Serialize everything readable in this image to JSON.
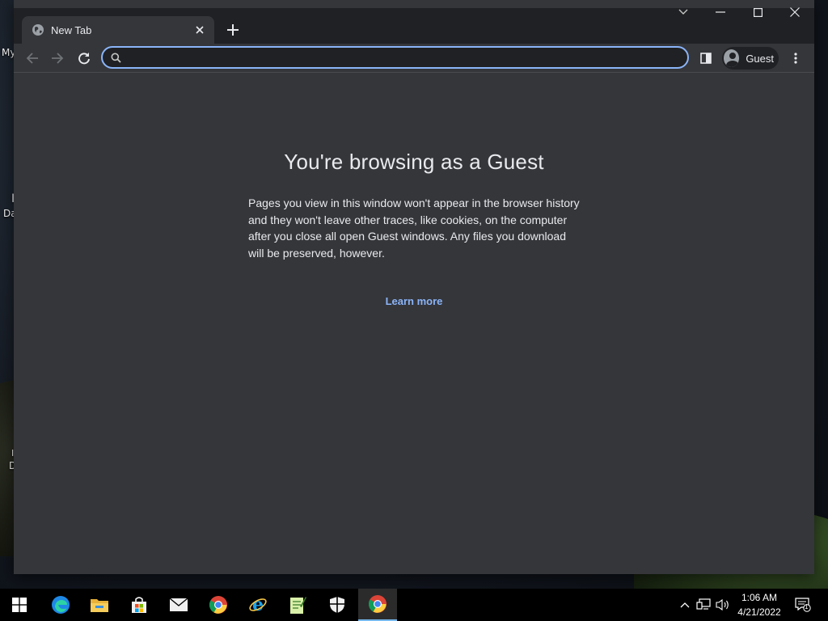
{
  "desktop": {
    "labels": [
      "My",
      "I",
      "Da",
      "I",
      "D"
    ]
  },
  "browser": {
    "tab": {
      "title": "New Tab",
      "icon": "globe-icon"
    },
    "window_controls": [
      "search-tabs-icon",
      "minimize-icon",
      "maximize-icon",
      "close-icon"
    ],
    "omnibox": {
      "value": "",
      "placeholder": ""
    },
    "profile": {
      "name": "Guest"
    }
  },
  "page": {
    "title": "You're browsing as a Guest",
    "description": "Pages you view in this window won't appear in the browser history and they won't leave other traces, like cookies, on the computer after you close all open Guest windows. Any files you download will be preserved, however.",
    "learn_more": "Learn more",
    "link_color": "#8ab4f8"
  },
  "taskbar": {
    "apps": [
      "start-icon",
      "edge-icon",
      "file-explorer-icon",
      "store-icon",
      "mail-icon",
      "chrome-icon",
      "internet-explorer-icon",
      "notepad-icon",
      "security-icon",
      "chrome-active-icon"
    ],
    "clock": {
      "time": "1:06 AM",
      "date": "4/21/2022"
    },
    "notification_count": "1"
  }
}
